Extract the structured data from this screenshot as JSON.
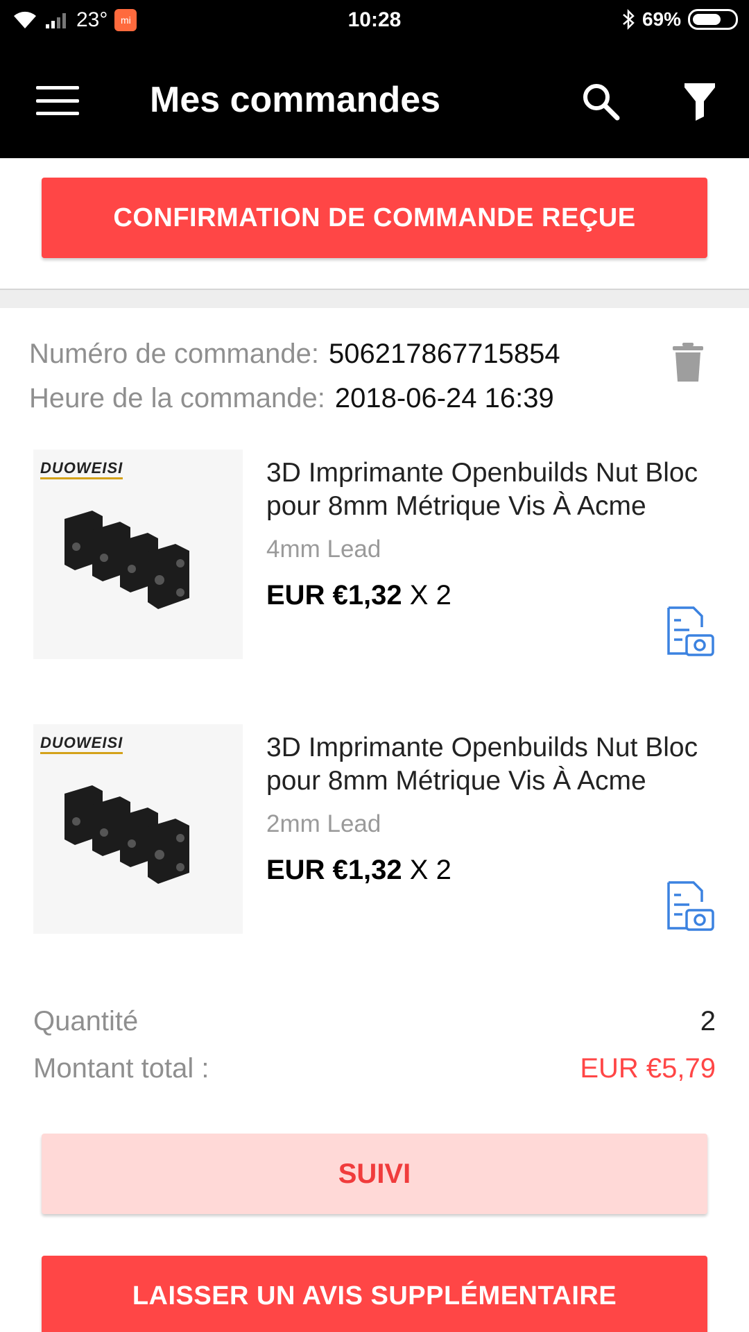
{
  "status_bar": {
    "temperature": "23°",
    "time": "10:28",
    "battery": "69%"
  },
  "app_bar": {
    "title": "Mes commandes",
    "menu_icon": "hamburger-menu-icon",
    "search_icon": "search-icon",
    "filter_icon": "filter-icon"
  },
  "confirm_button": {
    "label": "CONFIRMATION DE COMMANDE REÇUE"
  },
  "order": {
    "number_label": "Numéro de commande:",
    "number_value": "506217867715854",
    "time_label": "Heure de la commande:",
    "time_value": "2018-06-24 16:39",
    "delete_icon": "trash-icon"
  },
  "products": [
    {
      "brand": "DUOWEISI",
      "title": "3D Imprimante Openbuilds Nut Bloc pour 8mm Métrique Vis À Acme",
      "variant": "4mm Lead",
      "price": "EUR €1,32",
      "quantity": "X 2"
    },
    {
      "brand": "DUOWEISI",
      "title": "3D Imprimante Openbuilds Nut Bloc pour 8mm Métrique Vis À Acme",
      "variant": "2mm Lead",
      "price": "EUR €1,32",
      "quantity": "X 2"
    }
  ],
  "totals": {
    "quantity_label": "Quantité",
    "quantity_value": "2",
    "amount_label": "Montant total :",
    "amount_value": "EUR €5,79"
  },
  "tracking_button": {
    "label": "SUIVI"
  },
  "review_button": {
    "label": "LAISSER UN AVIS SUPPLÉMENTAIRE"
  },
  "colors": {
    "accent_red": "#ff4646",
    "light_red": "#ffd9d7",
    "icon_blue": "#3b82e0",
    "app_bar": "#000000"
  }
}
